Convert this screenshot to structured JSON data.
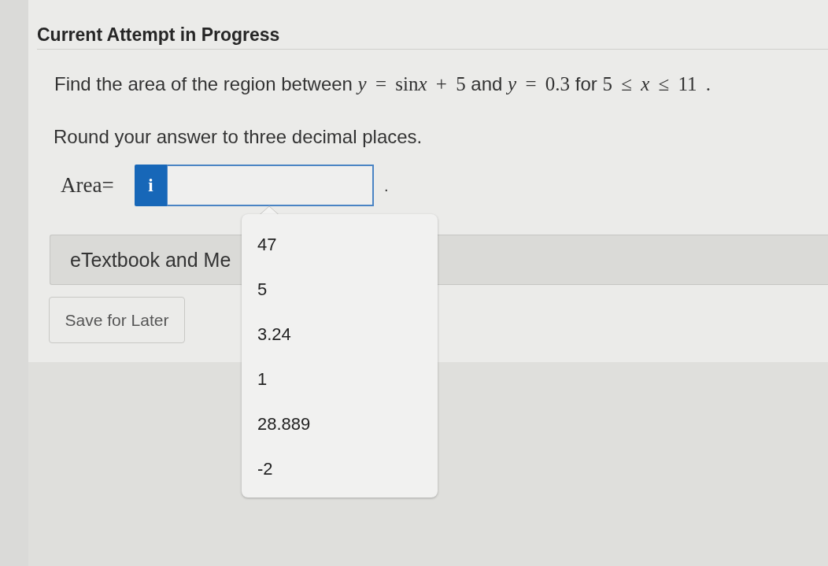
{
  "header": {
    "title": "Current Attempt in Progress"
  },
  "question": {
    "segments": [
      {
        "kind": "text",
        "text": "Find the area of the region between "
      },
      {
        "kind": "var",
        "text": "y"
      },
      {
        "kind": "math",
        "text": " = sin"
      },
      {
        "kind": "var",
        "text": "x"
      },
      {
        "kind": "math",
        "text": " + 5"
      },
      {
        "kind": "text",
        "text": " and "
      },
      {
        "kind": "var",
        "text": "y"
      },
      {
        "kind": "math",
        "text": " = 0.3"
      },
      {
        "kind": "text",
        "text": " for "
      },
      {
        "kind": "math",
        "text": "5 ≤ "
      },
      {
        "kind": "var",
        "text": "x"
      },
      {
        "kind": "math",
        "text": " ≤ 11 ."
      }
    ],
    "instruction": "Round your answer to three decimal places."
  },
  "answer": {
    "label": "Area=",
    "info_button": "i",
    "suffix": "."
  },
  "suggestions": [
    {
      "text": "47",
      "selected": false
    },
    {
      "text": "5",
      "selected": false
    },
    {
      "text": "3.24",
      "selected": false
    },
    {
      "text": "1",
      "selected": false
    },
    {
      "text": "28.889",
      "selected": false
    },
    {
      "text": "-2",
      "selected": false
    }
  ],
  "media_section": {
    "title": "eTextbook and Me"
  },
  "buttons": [
    {
      "label": "Save for Later"
    }
  ]
}
